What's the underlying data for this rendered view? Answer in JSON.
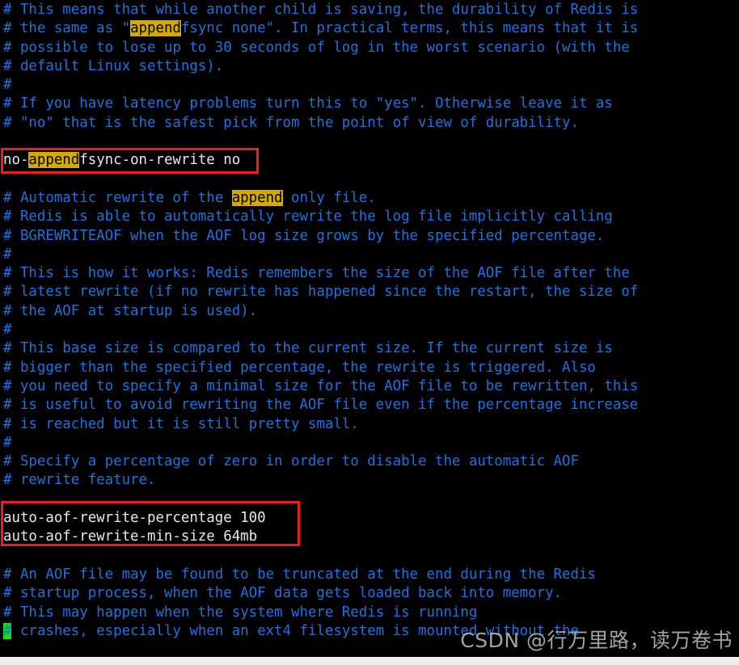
{
  "terminal": {
    "background_color": "#000000",
    "comment_color": "#1c72e0",
    "value_color": "#e8e8e8",
    "highlight_bg": "#d4aa00",
    "highlight_fg": "#000000",
    "cursor_color": "#16e016",
    "annotation_color": "#ee1b22",
    "search_term": "append",
    "lines": [
      {
        "id": 1,
        "type": "comment",
        "segments": [
          {
            "text": "# This means that while another child is saving, the durability of Redis is"
          }
        ]
      },
      {
        "id": 2,
        "type": "comment",
        "segments": [
          {
            "text": "# the same as \""
          },
          {
            "text": "append",
            "highlight": true
          },
          {
            "text": "fsync none\". In practical terms, this means that it is"
          }
        ]
      },
      {
        "id": 3,
        "type": "comment",
        "segments": [
          {
            "text": "# possible to lose up to 30 seconds of log in the worst scenario (with the"
          }
        ]
      },
      {
        "id": 4,
        "type": "comment",
        "segments": [
          {
            "text": "# default Linux settings)."
          }
        ]
      },
      {
        "id": 5,
        "type": "comment",
        "segments": [
          {
            "text": "#"
          }
        ]
      },
      {
        "id": 6,
        "type": "comment",
        "segments": [
          {
            "text": "# If you have latency problems turn this to \"yes\". Otherwise leave it as"
          }
        ]
      },
      {
        "id": 7,
        "type": "comment",
        "segments": [
          {
            "text": "# \"no\" that is the safest pick from the point of view of durability."
          }
        ]
      },
      {
        "id": 8,
        "type": "blank",
        "segments": [
          {
            "text": ""
          }
        ]
      },
      {
        "id": 9,
        "type": "value",
        "segments": [
          {
            "text": "no-"
          },
          {
            "text": "append",
            "highlight": true
          },
          {
            "text": "fsync-on-rewrite no"
          }
        ]
      },
      {
        "id": 10,
        "type": "blank",
        "segments": [
          {
            "text": ""
          }
        ]
      },
      {
        "id": 11,
        "type": "comment",
        "segments": [
          {
            "text": "# Automatic rewrite of the "
          },
          {
            "text": "append",
            "highlight": true
          },
          {
            "text": " only file."
          }
        ]
      },
      {
        "id": 12,
        "type": "comment",
        "segments": [
          {
            "text": "# Redis is able to automatically rewrite the log file implicitly calling"
          }
        ]
      },
      {
        "id": 13,
        "type": "comment",
        "segments": [
          {
            "text": "# BGREWRITEAOF when the AOF log size grows by the specified percentage."
          }
        ]
      },
      {
        "id": 14,
        "type": "comment",
        "segments": [
          {
            "text": "#"
          }
        ]
      },
      {
        "id": 15,
        "type": "comment",
        "segments": [
          {
            "text": "# This is how it works: Redis remembers the size of the AOF file after the"
          }
        ]
      },
      {
        "id": 16,
        "type": "comment",
        "segments": [
          {
            "text": "# latest rewrite (if no rewrite has happened since the restart, the size of"
          }
        ]
      },
      {
        "id": 17,
        "type": "comment",
        "segments": [
          {
            "text": "# the AOF at startup is used)."
          }
        ]
      },
      {
        "id": 18,
        "type": "comment",
        "segments": [
          {
            "text": "#"
          }
        ]
      },
      {
        "id": 19,
        "type": "comment",
        "segments": [
          {
            "text": "# This base size is compared to the current size. If the current size is"
          }
        ]
      },
      {
        "id": 20,
        "type": "comment",
        "segments": [
          {
            "text": "# bigger than the specified percentage, the rewrite is triggered. Also"
          }
        ]
      },
      {
        "id": 21,
        "type": "comment",
        "segments": [
          {
            "text": "# you need to specify a minimal size for the AOF file to be rewritten, this"
          }
        ]
      },
      {
        "id": 22,
        "type": "comment",
        "segments": [
          {
            "text": "# is useful to avoid rewriting the AOF file even if the percentage increase"
          }
        ]
      },
      {
        "id": 23,
        "type": "comment",
        "segments": [
          {
            "text": "# is reached but it is still pretty small."
          }
        ]
      },
      {
        "id": 24,
        "type": "comment",
        "segments": [
          {
            "text": "#"
          }
        ]
      },
      {
        "id": 25,
        "type": "comment",
        "segments": [
          {
            "text": "# Specify a percentage of zero in order to disable the automatic AOF"
          }
        ]
      },
      {
        "id": 26,
        "type": "comment",
        "segments": [
          {
            "text": "# rewrite feature."
          }
        ]
      },
      {
        "id": 27,
        "type": "blank",
        "segments": [
          {
            "text": ""
          }
        ]
      },
      {
        "id": 28,
        "type": "value",
        "segments": [
          {
            "text": "auto-aof-rewrite-percentage 100"
          }
        ]
      },
      {
        "id": 29,
        "type": "value",
        "segments": [
          {
            "text": "auto-aof-rewrite-min-size 64mb"
          }
        ]
      },
      {
        "id": 30,
        "type": "blank",
        "segments": [
          {
            "text": ""
          }
        ]
      },
      {
        "id": 31,
        "type": "comment",
        "segments": [
          {
            "text": "# An AOF file may be found to be truncated at the end during the Redis"
          }
        ]
      },
      {
        "id": 32,
        "type": "comment",
        "segments": [
          {
            "text": "# startup process, when the AOF data gets loaded back into memory."
          }
        ]
      },
      {
        "id": 33,
        "type": "comment",
        "segments": [
          {
            "text": "# This may happen when the system where Redis is running"
          }
        ]
      },
      {
        "id": 34,
        "type": "comment",
        "segments": [
          {
            "text": "#",
            "cursor": true
          },
          {
            "text": " crashes, especially when an ext4 filesystem is mounted without the"
          }
        ]
      }
    ]
  },
  "annotations": {
    "box_1_label": "no-appendfsync-on-rewrite no",
    "box_2_label": "auto-aof-rewrite-percentage 100 / auto-aof-rewrite-min-size 64mb"
  },
  "watermark": {
    "text": "CSDN @行万里路，读万卷书"
  }
}
